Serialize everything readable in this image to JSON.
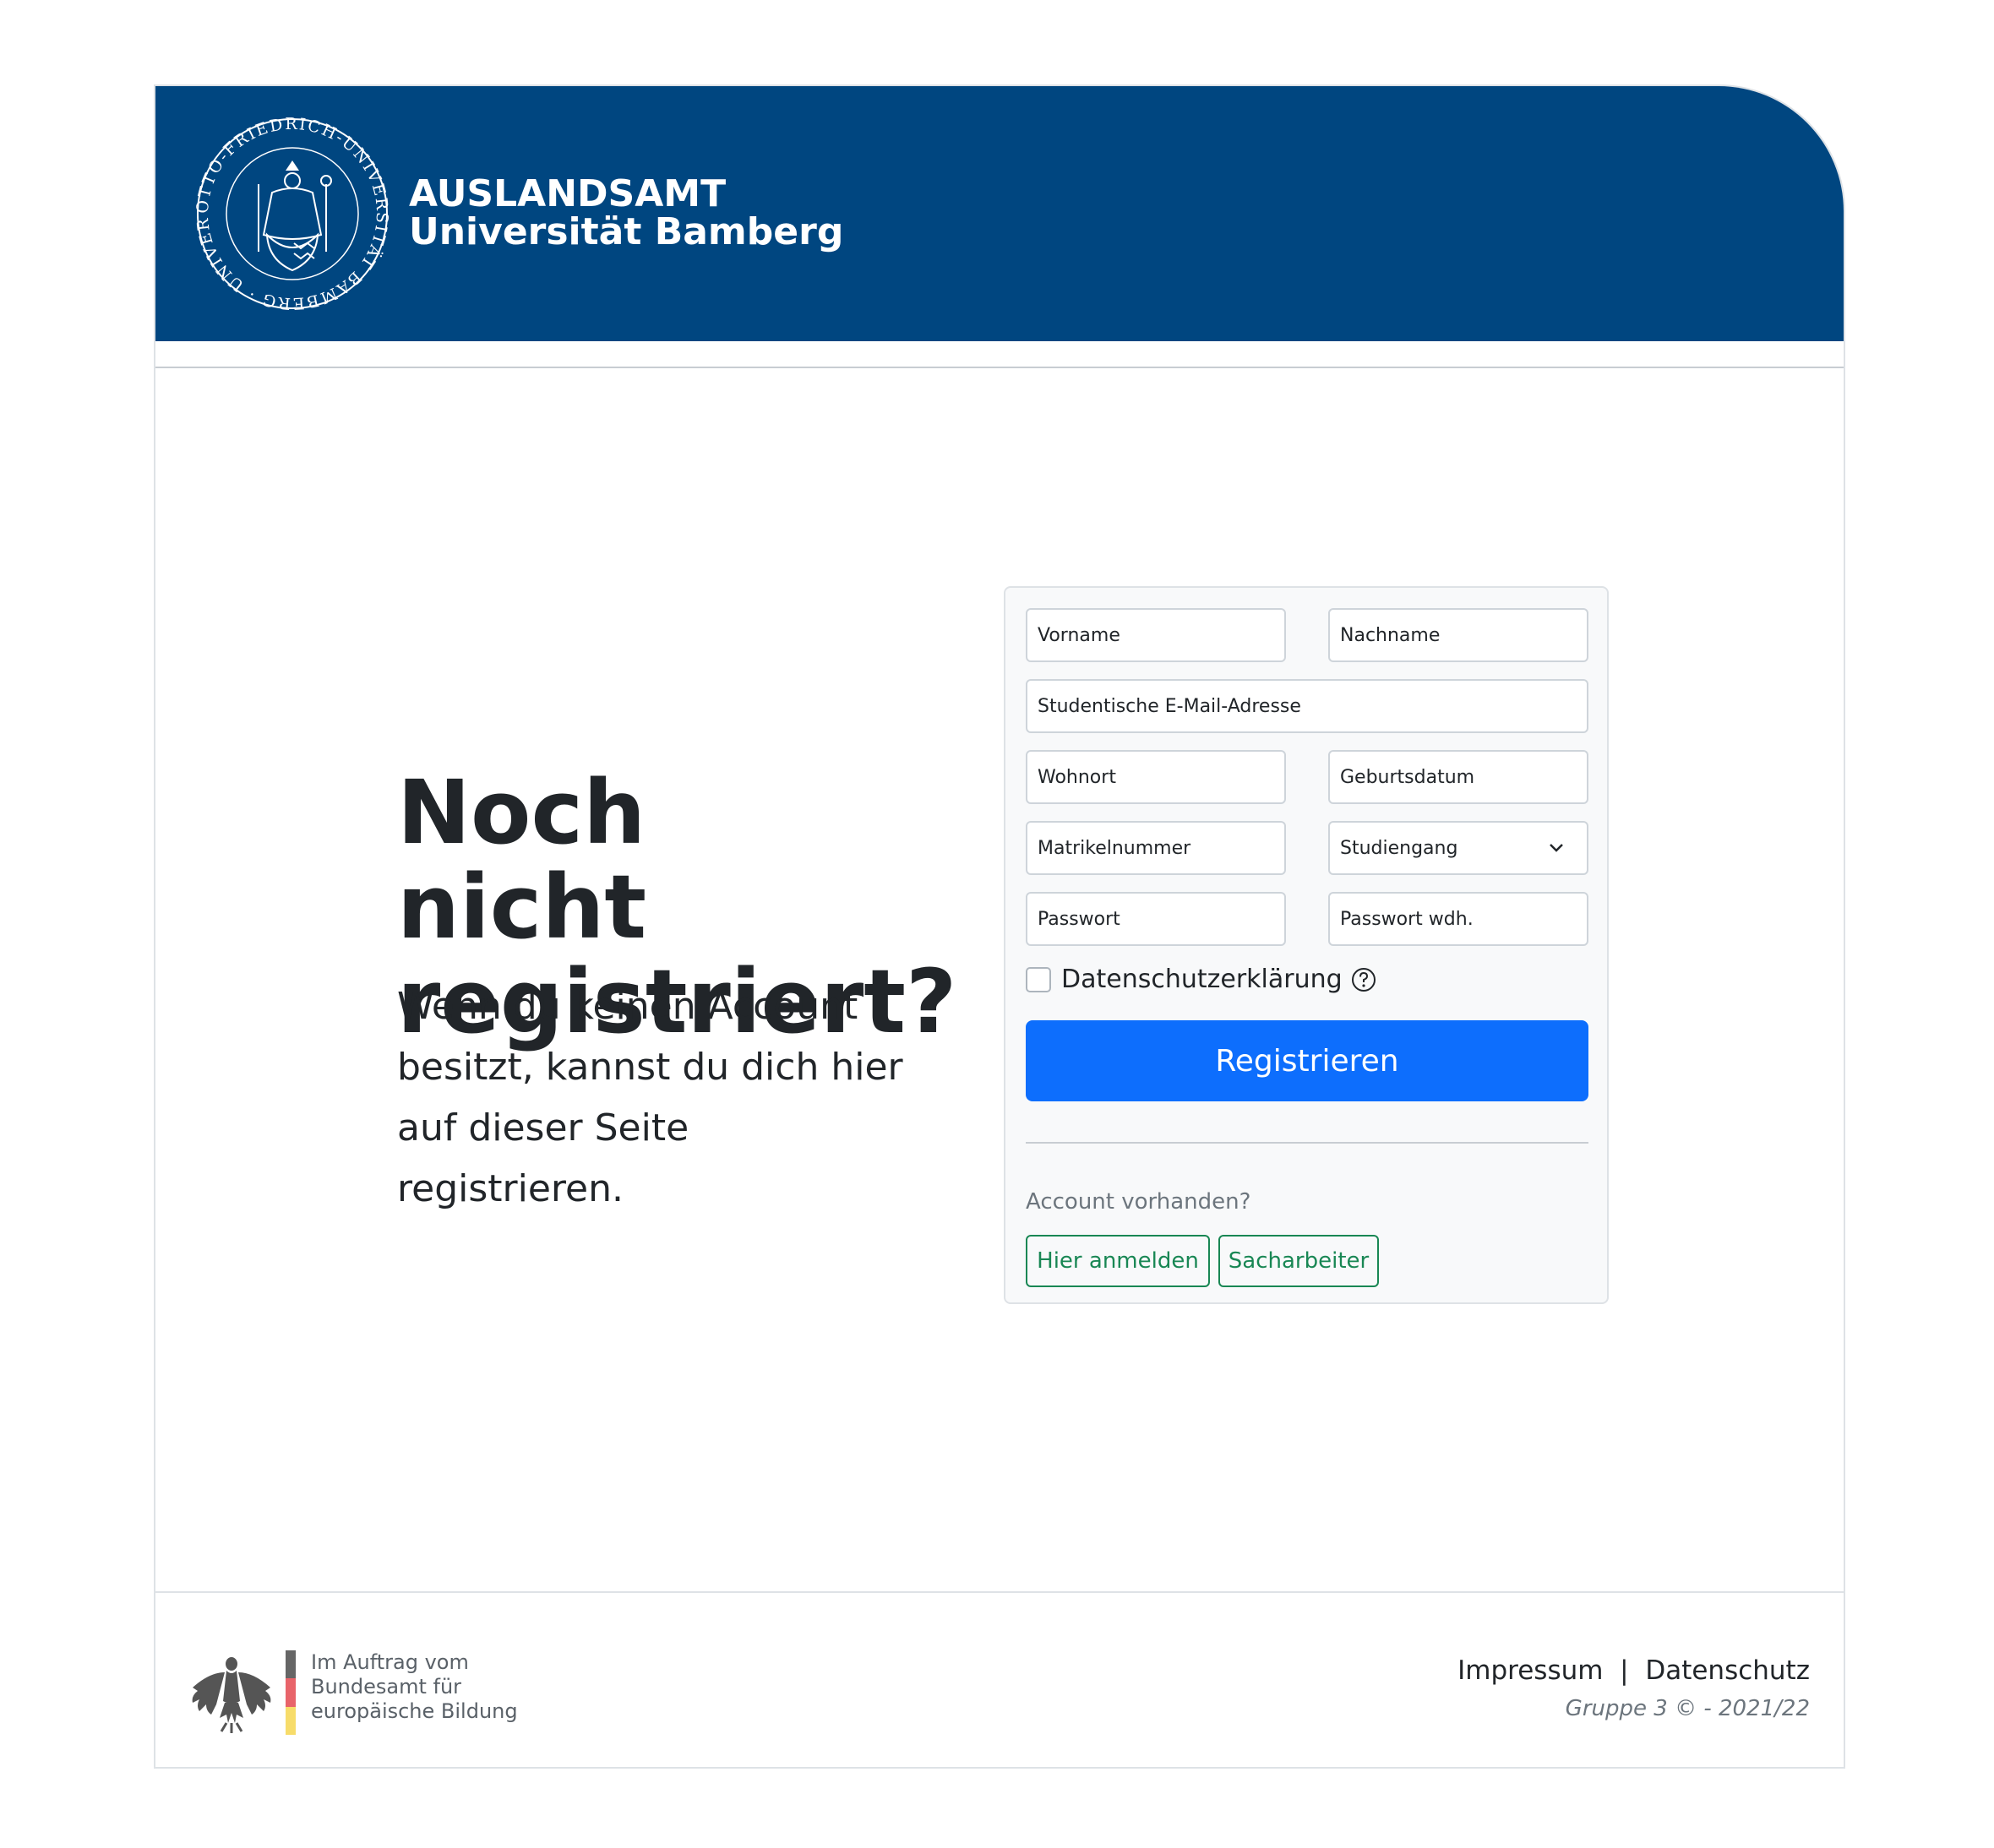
{
  "header": {
    "seal_text": "OTTO-FRIEDRICH-UNIVERSITÄT BAMBERG · UNIVERSITY OF BAMBERG · SOTTO",
    "brand_line1": "AUSLANDSAMT",
    "brand_line2": "Universität Bamberg",
    "bg_color": "#004680"
  },
  "hero": {
    "title": "Noch nicht registriert?",
    "text": "Wenn du keinen Account besitzt, kannst du dich hier auf dieser Seite registrieren."
  },
  "form": {
    "first_name_placeholder": "Vorname",
    "last_name_placeholder": "Nachname",
    "email_placeholder": "Studentische E-Mail-Adresse",
    "city_placeholder": "Wohnort",
    "birthdate_placeholder": "Geburtsdatum",
    "student_id_placeholder": "Matrikelnummer",
    "study_program_selected": "Studiengang",
    "password_placeholder": "Passwort",
    "password_repeat_placeholder": "Passwort wdh.",
    "privacy_label": "Datenschutzerklärung",
    "privacy_checked": false,
    "register_label": "Registrieren",
    "register_color": "#0d6efd",
    "account_label": "Account vorhanden?",
    "login_label": "Hier anmelden",
    "clerk_label": "Sacharbeiter",
    "outline_color": "#198754"
  },
  "footer": {
    "funding_line1": "Im Auftrag vom",
    "funding_line2": "Bundesamt für",
    "funding_line3": "europäische Bildung",
    "imprint_label": "Impressum",
    "separator": "|",
    "privacy_link_label": "Datenschutz",
    "copyright": "Gruppe 3 © - 2021/22"
  }
}
